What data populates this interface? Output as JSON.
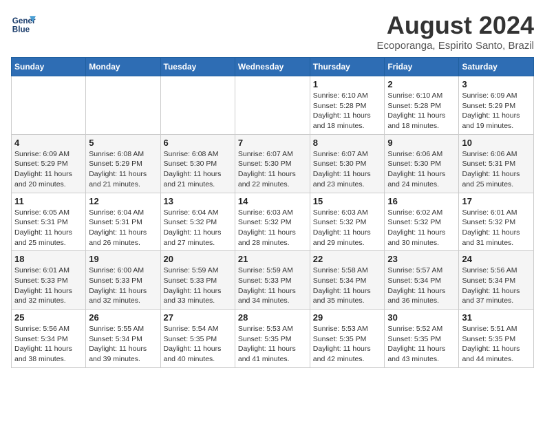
{
  "logo": {
    "line1": "General",
    "line2": "Blue"
  },
  "title": "August 2024",
  "location": "Ecoporanga, Espirito Santo, Brazil",
  "weekdays": [
    "Sunday",
    "Monday",
    "Tuesday",
    "Wednesday",
    "Thursday",
    "Friday",
    "Saturday"
  ],
  "weeks": [
    [
      {
        "day": "",
        "info": ""
      },
      {
        "day": "",
        "info": ""
      },
      {
        "day": "",
        "info": ""
      },
      {
        "day": "",
        "info": ""
      },
      {
        "day": "1",
        "info": "Sunrise: 6:10 AM\nSunset: 5:28 PM\nDaylight: 11 hours\nand 18 minutes."
      },
      {
        "day": "2",
        "info": "Sunrise: 6:10 AM\nSunset: 5:28 PM\nDaylight: 11 hours\nand 18 minutes."
      },
      {
        "day": "3",
        "info": "Sunrise: 6:09 AM\nSunset: 5:29 PM\nDaylight: 11 hours\nand 19 minutes."
      }
    ],
    [
      {
        "day": "4",
        "info": "Sunrise: 6:09 AM\nSunset: 5:29 PM\nDaylight: 11 hours\nand 20 minutes."
      },
      {
        "day": "5",
        "info": "Sunrise: 6:08 AM\nSunset: 5:29 PM\nDaylight: 11 hours\nand 21 minutes."
      },
      {
        "day": "6",
        "info": "Sunrise: 6:08 AM\nSunset: 5:30 PM\nDaylight: 11 hours\nand 21 minutes."
      },
      {
        "day": "7",
        "info": "Sunrise: 6:07 AM\nSunset: 5:30 PM\nDaylight: 11 hours\nand 22 minutes."
      },
      {
        "day": "8",
        "info": "Sunrise: 6:07 AM\nSunset: 5:30 PM\nDaylight: 11 hours\nand 23 minutes."
      },
      {
        "day": "9",
        "info": "Sunrise: 6:06 AM\nSunset: 5:30 PM\nDaylight: 11 hours\nand 24 minutes."
      },
      {
        "day": "10",
        "info": "Sunrise: 6:06 AM\nSunset: 5:31 PM\nDaylight: 11 hours\nand 25 minutes."
      }
    ],
    [
      {
        "day": "11",
        "info": "Sunrise: 6:05 AM\nSunset: 5:31 PM\nDaylight: 11 hours\nand 25 minutes."
      },
      {
        "day": "12",
        "info": "Sunrise: 6:04 AM\nSunset: 5:31 PM\nDaylight: 11 hours\nand 26 minutes."
      },
      {
        "day": "13",
        "info": "Sunrise: 6:04 AM\nSunset: 5:32 PM\nDaylight: 11 hours\nand 27 minutes."
      },
      {
        "day": "14",
        "info": "Sunrise: 6:03 AM\nSunset: 5:32 PM\nDaylight: 11 hours\nand 28 minutes."
      },
      {
        "day": "15",
        "info": "Sunrise: 6:03 AM\nSunset: 5:32 PM\nDaylight: 11 hours\nand 29 minutes."
      },
      {
        "day": "16",
        "info": "Sunrise: 6:02 AM\nSunset: 5:32 PM\nDaylight: 11 hours\nand 30 minutes."
      },
      {
        "day": "17",
        "info": "Sunrise: 6:01 AM\nSunset: 5:32 PM\nDaylight: 11 hours\nand 31 minutes."
      }
    ],
    [
      {
        "day": "18",
        "info": "Sunrise: 6:01 AM\nSunset: 5:33 PM\nDaylight: 11 hours\nand 32 minutes."
      },
      {
        "day": "19",
        "info": "Sunrise: 6:00 AM\nSunset: 5:33 PM\nDaylight: 11 hours\nand 32 minutes."
      },
      {
        "day": "20",
        "info": "Sunrise: 5:59 AM\nSunset: 5:33 PM\nDaylight: 11 hours\nand 33 minutes."
      },
      {
        "day": "21",
        "info": "Sunrise: 5:59 AM\nSunset: 5:33 PM\nDaylight: 11 hours\nand 34 minutes."
      },
      {
        "day": "22",
        "info": "Sunrise: 5:58 AM\nSunset: 5:34 PM\nDaylight: 11 hours\nand 35 minutes."
      },
      {
        "day": "23",
        "info": "Sunrise: 5:57 AM\nSunset: 5:34 PM\nDaylight: 11 hours\nand 36 minutes."
      },
      {
        "day": "24",
        "info": "Sunrise: 5:56 AM\nSunset: 5:34 PM\nDaylight: 11 hours\nand 37 minutes."
      }
    ],
    [
      {
        "day": "25",
        "info": "Sunrise: 5:56 AM\nSunset: 5:34 PM\nDaylight: 11 hours\nand 38 minutes."
      },
      {
        "day": "26",
        "info": "Sunrise: 5:55 AM\nSunset: 5:34 PM\nDaylight: 11 hours\nand 39 minutes."
      },
      {
        "day": "27",
        "info": "Sunrise: 5:54 AM\nSunset: 5:35 PM\nDaylight: 11 hours\nand 40 minutes."
      },
      {
        "day": "28",
        "info": "Sunrise: 5:53 AM\nSunset: 5:35 PM\nDaylight: 11 hours\nand 41 minutes."
      },
      {
        "day": "29",
        "info": "Sunrise: 5:53 AM\nSunset: 5:35 PM\nDaylight: 11 hours\nand 42 minutes."
      },
      {
        "day": "30",
        "info": "Sunrise: 5:52 AM\nSunset: 5:35 PM\nDaylight: 11 hours\nand 43 minutes."
      },
      {
        "day": "31",
        "info": "Sunrise: 5:51 AM\nSunset: 5:35 PM\nDaylight: 11 hours\nand 44 minutes."
      }
    ]
  ]
}
